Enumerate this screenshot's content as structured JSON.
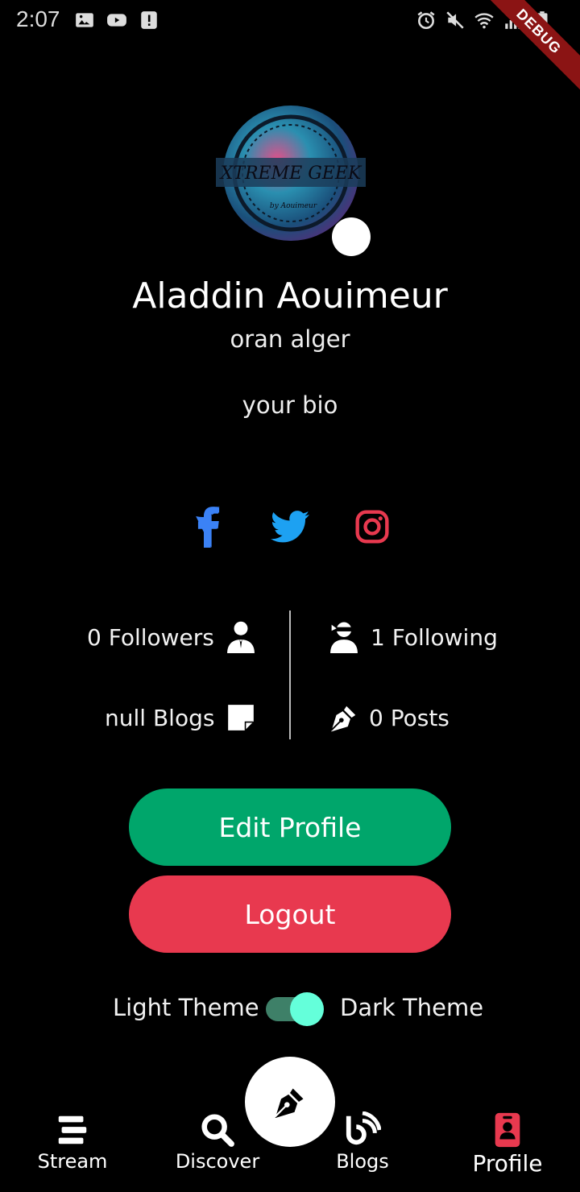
{
  "status_bar": {
    "time": "2:07",
    "debug_label": "DEBUG"
  },
  "profile": {
    "avatar_text_main": "XTREME GEEK",
    "avatar_text_sub": "by Aouimeur",
    "name": "Aladdin Aouimeur",
    "location": "oran alger",
    "bio": "your bio"
  },
  "socials": {
    "facebook_color": "#3b82f6",
    "twitter_color": "#1da1f2",
    "instagram_color": "#e8394f"
  },
  "stats": {
    "followers": "0 Followers",
    "following": "1 Following",
    "blogs": "null Blogs",
    "posts": "0 Posts"
  },
  "actions": {
    "edit_profile": "Edit Profile",
    "logout": "Logout",
    "edit_color": "#00a66b",
    "logout_color": "#e8394f"
  },
  "theme": {
    "light_label": "Light Theme",
    "dark_label": "Dark Theme",
    "dark_enabled": true
  },
  "bottom_nav": {
    "items": [
      {
        "label": "Stream",
        "icon": "stream-icon"
      },
      {
        "label": "Discover",
        "icon": "search-icon"
      },
      {
        "label": "Blogs",
        "icon": "blog-icon"
      },
      {
        "label": "Profile",
        "icon": "profile-badge-icon",
        "active": true
      }
    ],
    "active_color": "#e8394f"
  }
}
